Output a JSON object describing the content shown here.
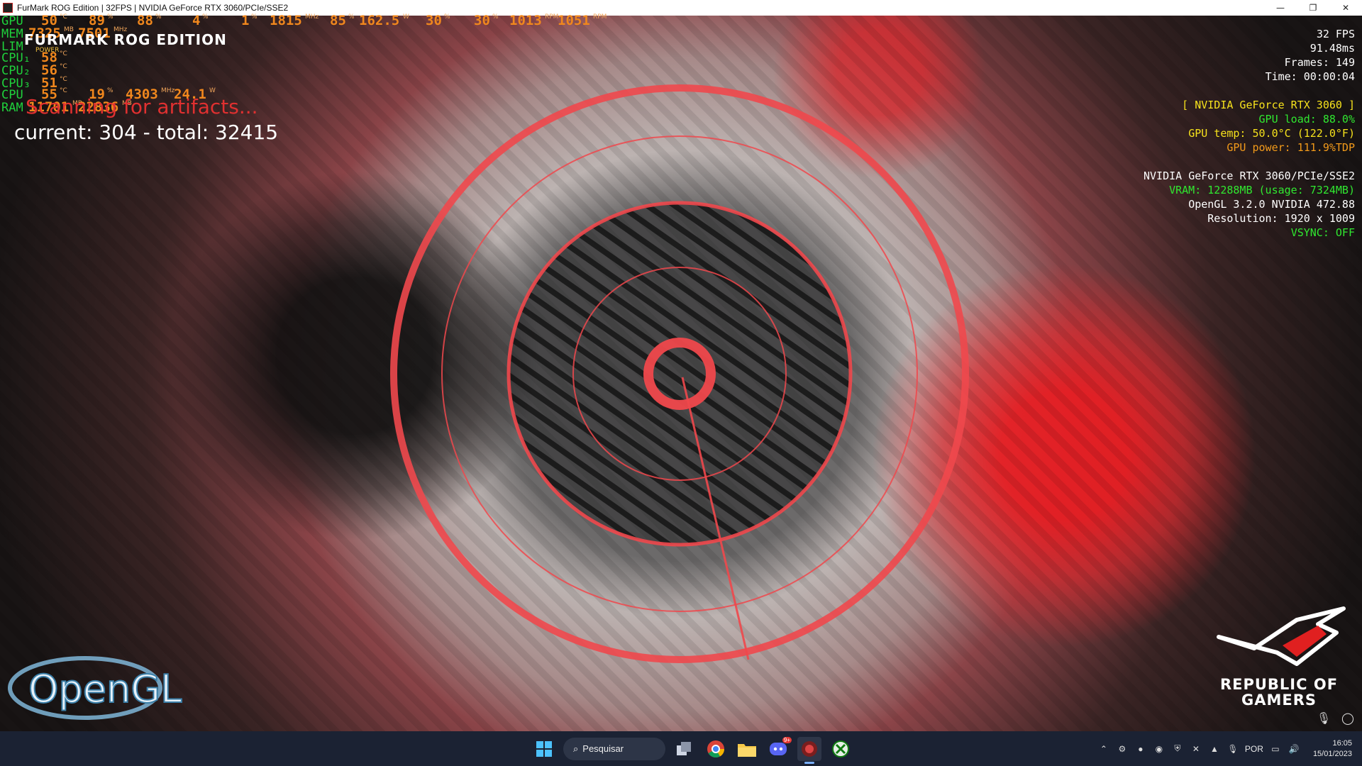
{
  "window": {
    "title": "FurMark ROG Edition | 32FPS | NVIDIA GeForce RTX 3060/PCIe/SSE2",
    "controls": [
      "—",
      "❐",
      "✕"
    ]
  },
  "hud_left": {
    "rows": [
      {
        "label": "GPU",
        "values": [
          {
            "v": "50",
            "u": "°C"
          },
          {
            "v": "89",
            "u": "%"
          },
          {
            "v": "88",
            "u": "%"
          },
          {
            "v": "4",
            "u": "%"
          },
          {
            "v": "1",
            "u": "%"
          },
          {
            "v": "1815",
            "u": "MHz"
          },
          {
            "v": "85",
            "u": "%"
          },
          {
            "v": "162.5",
            "u": "W"
          },
          {
            "v": "30",
            "u": "%"
          },
          {
            "v": "30",
            "u": "%"
          },
          {
            "v": "1013",
            "u": "RPM"
          },
          {
            "v": "1051",
            "u": "RPM"
          }
        ]
      },
      {
        "label": "MEM",
        "values": [
          {
            "v": "7325",
            "u": "MB"
          },
          {
            "v": "7501",
            "u": "MHz"
          }
        ]
      },
      {
        "label": "LIM",
        "values": []
      },
      {
        "label": "CPU₁",
        "values": [
          {
            "v": "58",
            "u": "°C"
          }
        ]
      },
      {
        "label": "CPU₂",
        "values": [
          {
            "v": "56",
            "u": "°C"
          }
        ]
      },
      {
        "label": "CPU₃",
        "values": [
          {
            "v": "51",
            "u": "°C"
          }
        ]
      },
      {
        "label": "CPU",
        "values": [
          {
            "v": "55",
            "u": "°C"
          },
          {
            "v": "19",
            "u": "%"
          },
          {
            "v": "4303",
            "u": "MHz"
          },
          {
            "v": "24.1",
            "u": "W"
          }
        ]
      },
      {
        "label": "RAM",
        "values": [
          {
            "v": "11701",
            "u": "MB"
          },
          {
            "v": "22836",
            "u": "MB"
          }
        ]
      }
    ],
    "power_tag": "POWER",
    "logo": "FURMARK ROG EDITION",
    "scan": "Scanning for artifacts...",
    "current": "current: 304 - total: 32415"
  },
  "hud_right": {
    "fps": "32 FPS",
    "ms": "91.48ms",
    "frames": "Frames: 149",
    "time": "Time: 00:00:04",
    "gpu_name": "[ NVIDIA GeForce RTX 3060 ]",
    "gpu_load": "GPU load: 88.0%",
    "gpu_temp": "GPU temp: 50.0°C (122.0°F)",
    "gpu_power": "GPU power: 111.9%TDP",
    "renderer": "NVIDIA GeForce RTX 3060/PCIe/SSE2",
    "vram": "VRAM: 12288MB (usage: 7324MB)",
    "opengl": "OpenGL 3.2.0 NVIDIA 472.88",
    "resolution": "Resolution: 1920 x 1009",
    "vsync": "VSYNC: OFF"
  },
  "branding": {
    "opengl_logo": "OpenGL",
    "rog_line1": "REPUBLIC OF",
    "rog_line2": "GAMERS"
  },
  "taskbar": {
    "search_label": "Pesquisar",
    "discord_badge": "9+",
    "lang": "POR",
    "time": "16:05",
    "date": "15/01/2023"
  }
}
